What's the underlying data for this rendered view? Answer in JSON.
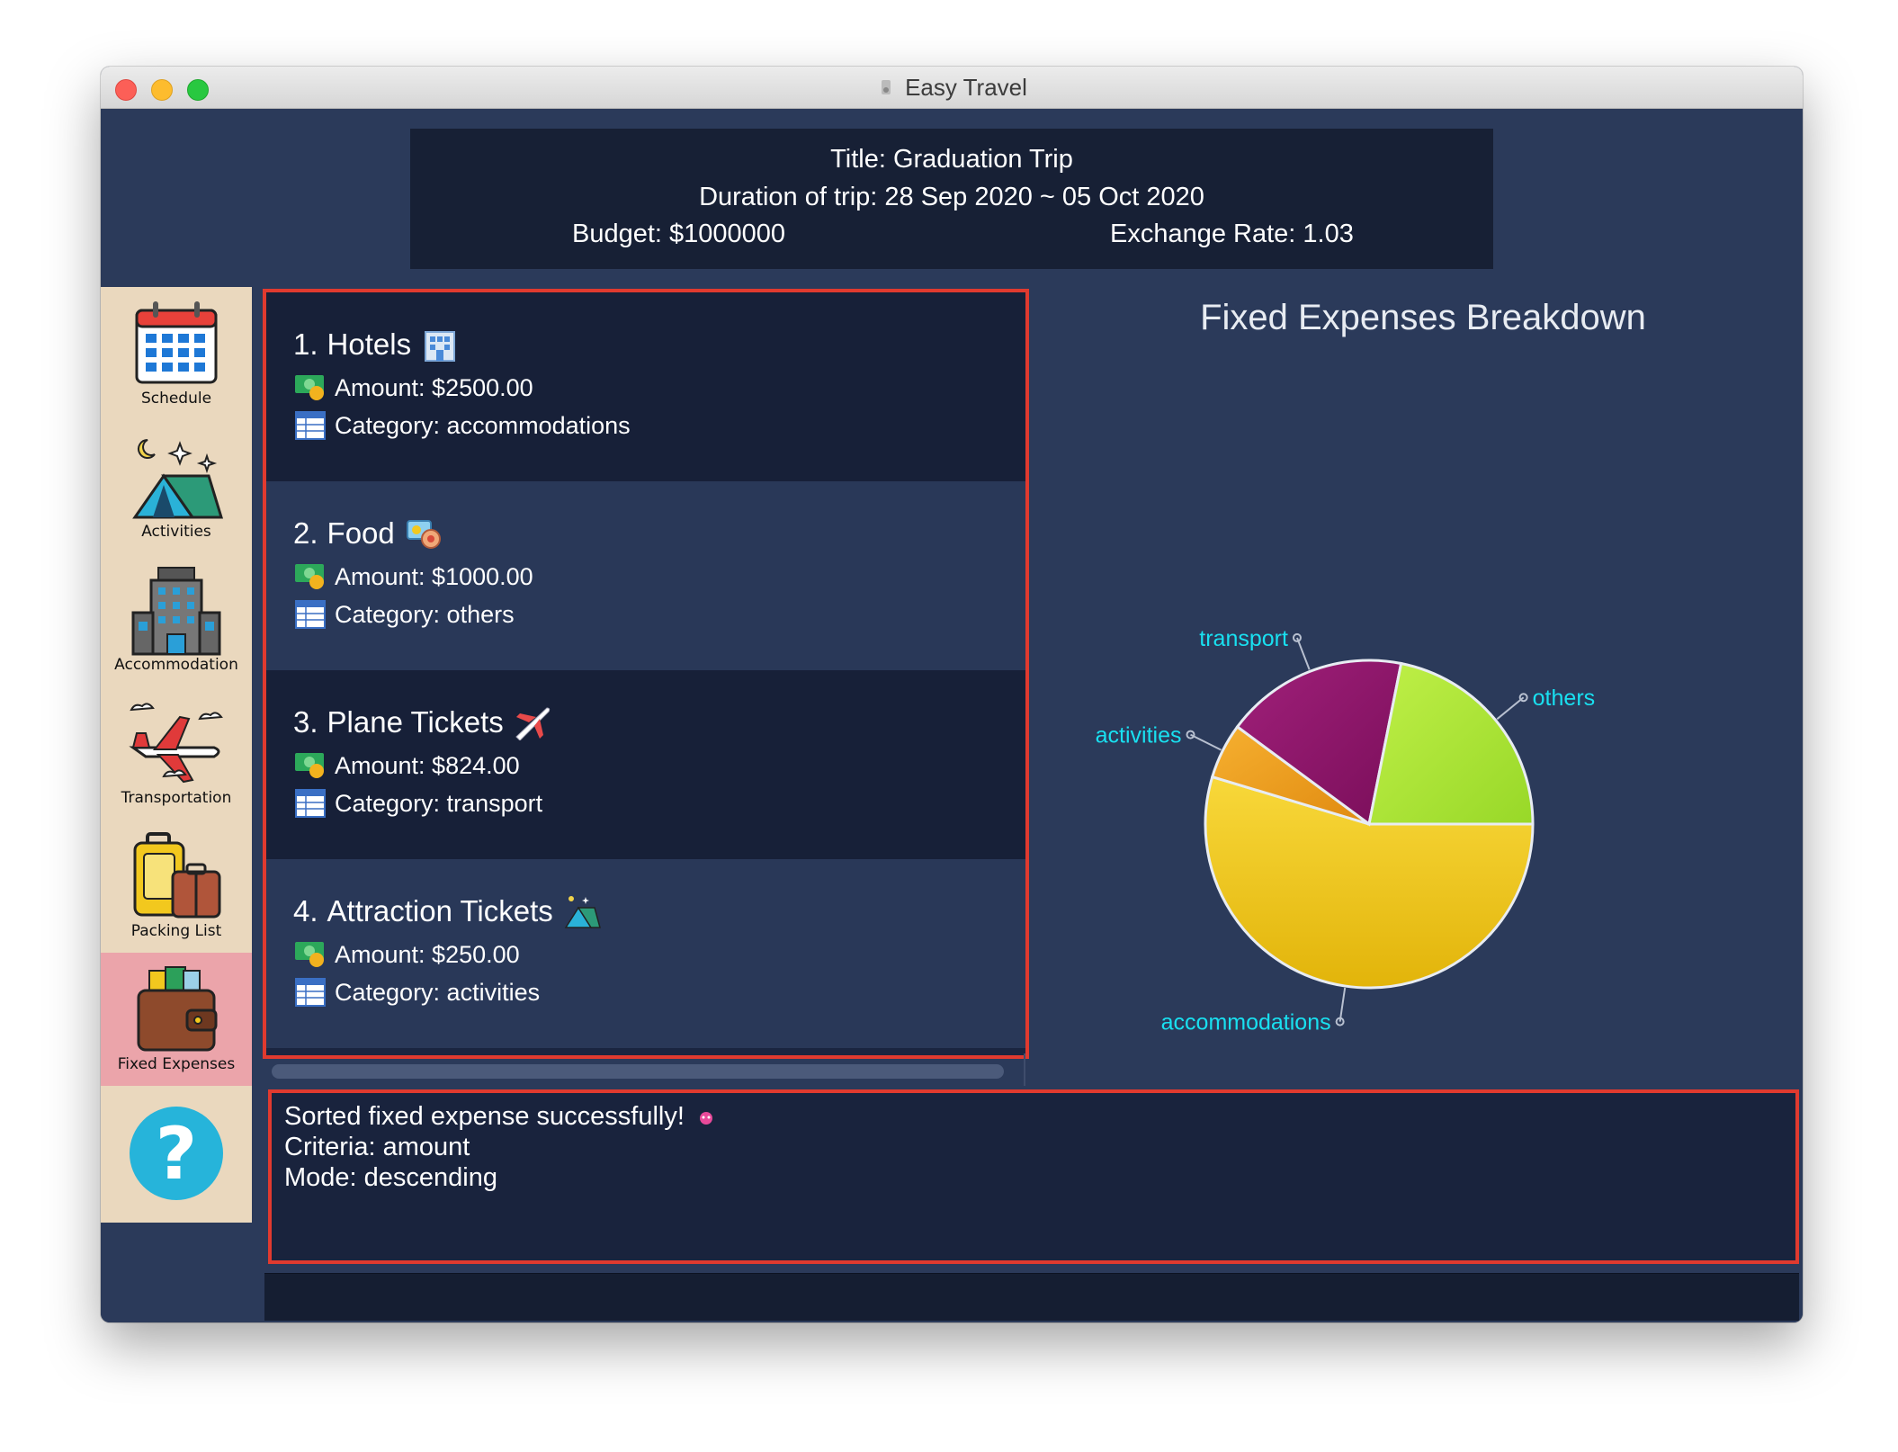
{
  "window": {
    "title": "Easy Travel"
  },
  "header": {
    "title": "Title: Graduation Trip",
    "duration": "Duration of trip: 28 Sep 2020 ~ 05 Oct 2020",
    "budget": "Budget: $1000000",
    "exchange_rate": "Exchange Rate: 1.03"
  },
  "sidebar": {
    "items": [
      {
        "label": "Schedule",
        "icon": "calendar-icon"
      },
      {
        "label": "Activities",
        "icon": "tent-icon"
      },
      {
        "label": "Accommodation",
        "icon": "hotel-building-icon"
      },
      {
        "label": "Transportation",
        "icon": "airplane-icon"
      },
      {
        "label": "Packing List",
        "icon": "luggage-icon"
      },
      {
        "label": "Fixed Expenses",
        "icon": "wallet-icon",
        "active": true
      }
    ],
    "help_label": "?"
  },
  "expenses": [
    {
      "index": "1.",
      "name": "Hotels",
      "amount": "Amount: $2500.00",
      "category": "Category: accommodations",
      "icon": "hotel-icon"
    },
    {
      "index": "2.",
      "name": "Food",
      "amount": "Amount: $1000.00",
      "category": "Category: others",
      "icon": "food-icon"
    },
    {
      "index": "3.",
      "name": "Plane Tickets",
      "amount": "Amount: $824.00",
      "category": "Category: transport",
      "icon": "airplane-icon"
    },
    {
      "index": "4.",
      "name": "Attraction Tickets",
      "amount": "Amount: $250.00",
      "category": "Category: activities",
      "icon": "tent-icon"
    }
  ],
  "chart_data": {
    "type": "pie",
    "title": "Fixed Expenses Breakdown",
    "categories": [
      "accommodations",
      "activities",
      "transport",
      "others"
    ],
    "values": [
      2500,
      250,
      824,
      1000
    ],
    "colors": [
      "#f2cc1a",
      "#f0a020",
      "#8c1468",
      "#b0e83c"
    ],
    "label_color": "#19e0f0"
  },
  "result": {
    "line1": "Sorted fixed expense successfully!",
    "line2": "Criteria: amount",
    "line3": "Mode: descending"
  },
  "colors": {
    "background": "#2b3a5a",
    "panel_dark": "#172038",
    "panel_light": "#293858",
    "highlight_border": "#e03a2f",
    "sidebar": "#ead8be",
    "sidebar_active": "#eba4aa"
  }
}
